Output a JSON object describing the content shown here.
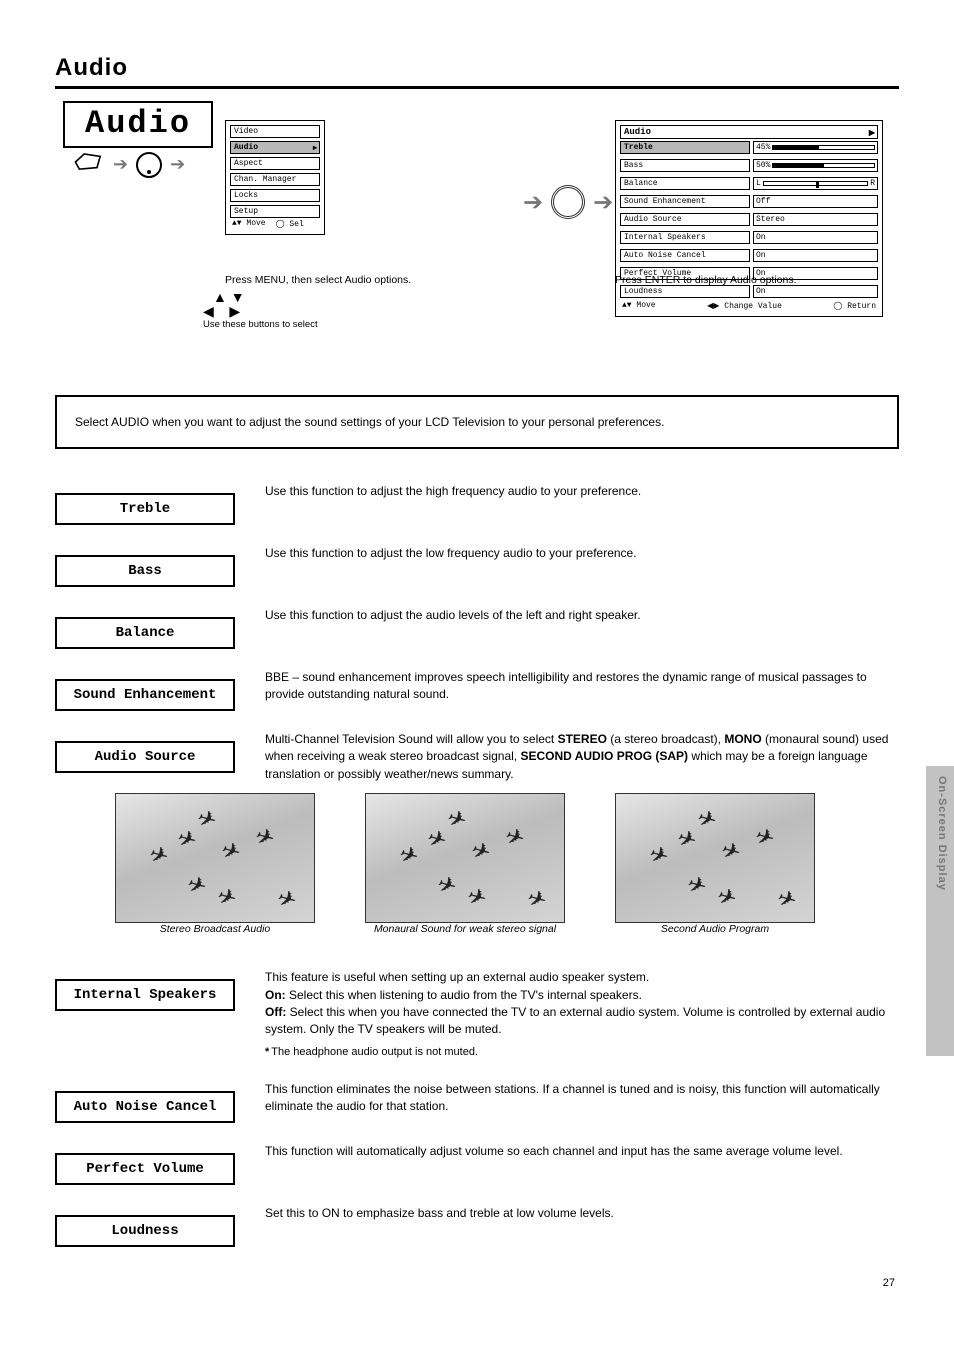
{
  "header": {
    "title": "Audio"
  },
  "titleBox": "Audio",
  "sequence": {
    "step1": "Press MENU, then select Audio options.",
    "step2": "Press ENTER to display Audio options."
  },
  "mainMenu": {
    "title": "",
    "items": [
      "Video",
      "Audio",
      "Aspect",
      "Chan. Manager",
      "Locks",
      "Setup"
    ],
    "selectedIndex": 1,
    "footer": {
      "move": "Move",
      "sel": "Sel"
    }
  },
  "audioMenu": {
    "title": "Audio",
    "rows": [
      {
        "label": "Treble",
        "value": "45%",
        "selected": true,
        "type": "bar",
        "fill": 45
      },
      {
        "label": "Bass",
        "value": "50%",
        "type": "bar",
        "fill": 50
      },
      {
        "label": "Balance",
        "value": "L        R",
        "type": "balance",
        "pos": 50
      },
      {
        "label": "Sound Enhancement",
        "value": "Off",
        "type": "text"
      },
      {
        "label": "Audio Source",
        "value": "Stereo",
        "type": "text"
      },
      {
        "label": "Internal Speakers",
        "value": "On",
        "type": "text"
      },
      {
        "label": "Auto Noise Cancel",
        "value": "On",
        "type": "text"
      },
      {
        "label": "Perfect Volume",
        "value": "On",
        "type": "text"
      },
      {
        "label": "Loudness",
        "value": "On",
        "type": "text"
      }
    ],
    "footer": {
      "move": "Move",
      "change": "Change Value",
      "return": "Return"
    }
  },
  "arrowsNote": "Use these\nbuttons\nto select",
  "introBanner": "Select AUDIO when you want to adjust the sound settings of your LCD Television to your personal preferences.",
  "items": {
    "treble": {
      "label": "Treble",
      "desc": "Use this function to adjust the high frequency audio to your preference."
    },
    "bass": {
      "label": "Bass",
      "desc": "Use this function to adjust the low frequency audio to your preference."
    },
    "balance": {
      "label": "Balance",
      "desc": "Use this function to adjust the audio levels of the left and right speaker."
    },
    "soundenh": {
      "label": "Sound Enhancement",
      "desc": "BBE – sound enhancement improves speech intelligibility and restores the dynamic range of musical passages to provide outstanding natural sound."
    },
    "audiosrc": {
      "label": "Audio Source",
      "lead": "Multi-Channel Television Sound will allow you to select ",
      "boldStereo": "STEREO",
      "between": " (a stereo broadcast), ",
      "boldMono": "MONO",
      "mid1": " (monaural sound) used when receiving a weak stereo broadcast signal, ",
      "boldSecond": "SECOND AUDIO PROG (SAP)",
      "tail": " which may be a foreign language translation or possibly weather/news summary."
    },
    "intspk": {
      "label": "Internal Speakers",
      "desc": "This feature is useful when setting up an external audio speaker system.",
      "onLabel": "On:",
      "onText": " Select this when listening to audio from the TV's internal speakers.",
      "offLabel": "Off:",
      "offText": " Select this when you have connected the TV to an external audio system. Volume is controlled by external audio system. Only the TV speakers will be muted.",
      "note": "The headphone audio output is not muted."
    },
    "anc": {
      "label": "Auto Noise Cancel",
      "desc": "This function eliminates the noise between stations. If a channel is tuned and is noisy, this function will automatically eliminate the audio for that station."
    },
    "pvol": {
      "label": "Perfect Volume",
      "desc": "This function will automatically adjust volume so each channel and input has the same average volume level."
    },
    "loud": {
      "label": "Loudness",
      "desc": "Set this to ON to emphasize bass and treble at low volume levels."
    }
  },
  "imageCaptions": {
    "stereo": "Stereo Broadcast Audio",
    "mono": "Monaural Sound for weak stereo signal",
    "sap": "Second Audio Program"
  },
  "sideTab": "On-Screen Display",
  "footer": "27"
}
